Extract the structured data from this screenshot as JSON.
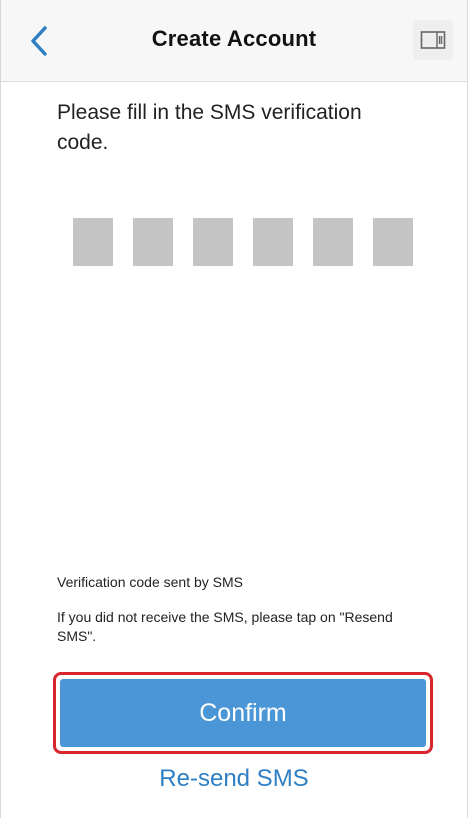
{
  "header": {
    "title": "Create Account",
    "back_icon": "chevron-left-icon",
    "action_icon": "id-card-icon",
    "accent_color": "#2f7fc4"
  },
  "main": {
    "prompt": "Please fill in the SMS verification code.",
    "code_length": 6,
    "sent_text": "Verification code sent by SMS",
    "resend_hint": "If you did not receive the SMS, please tap on \"Resend SMS\"."
  },
  "actions": {
    "confirm_label": "Confirm",
    "confirm_color": "#4a96d6",
    "highlight_color": "#d8262d",
    "resend_label": "Re-send SMS"
  }
}
